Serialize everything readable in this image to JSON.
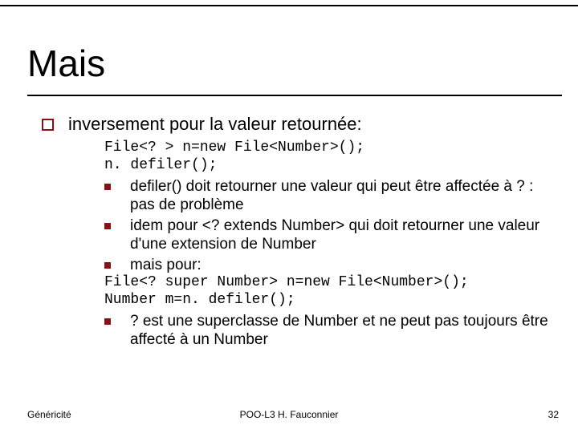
{
  "title": "Mais",
  "main_point": "inversement pour la valeur retournée:",
  "code_top_1": "File<? > n=new File<Number>();",
  "code_top_2": "n. defiler();",
  "bullet1": "defiler() doit retourner une valeur qui peut être affectée à ? : pas de problème",
  "bullet2": "idem pour <? extends Number> qui doit retourner une valeur d'une extension de Number",
  "bullet3": "mais pour:",
  "code_mid_1": "File<? super Number> n=new File<Number>();",
  "code_mid_2": "Number m=n. defiler();",
  "bullet4": "? est une superclasse de Number et ne peut pas toujours être affecté à un Number",
  "footer_left": "Généricité",
  "footer_center": "POO-L3 H. Fauconnier",
  "footer_right": "32"
}
